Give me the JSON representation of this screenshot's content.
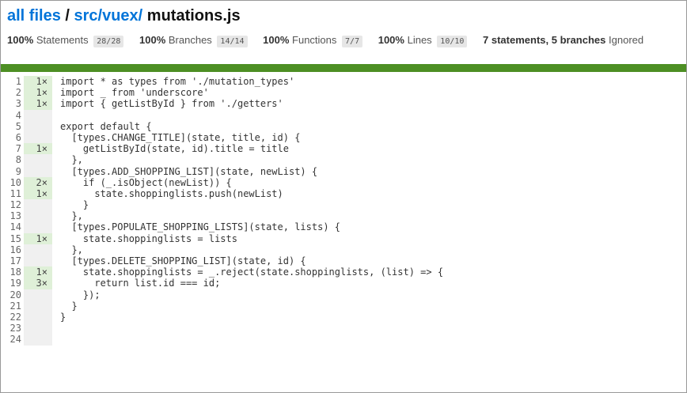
{
  "header": {
    "prefix": "all files",
    "sep1": " / ",
    "dir": "src/vuex/",
    "file": "mutations.js"
  },
  "summary": [
    {
      "pct": "100%",
      "label": "Statements",
      "frac": "28/28"
    },
    {
      "pct": "100%",
      "label": "Branches",
      "frac": "14/14"
    },
    {
      "pct": "100%",
      "label": "Functions",
      "frac": "7/7"
    },
    {
      "pct": "100%",
      "label": "Lines",
      "frac": "10/10"
    }
  ],
  "ignored": {
    "bold": "7 statements, 5 branches",
    "text": "Ignored"
  },
  "coverage_bar_color": "#4d8f24",
  "lines": [
    {
      "n": "1",
      "hits": "1×",
      "code": "import * as types from './mutation_types'"
    },
    {
      "n": "2",
      "hits": "1×",
      "code": "import _ from 'underscore'"
    },
    {
      "n": "3",
      "hits": "1×",
      "code": "import { getListById } from './getters'"
    },
    {
      "n": "4",
      "hits": "",
      "code": ""
    },
    {
      "n": "5",
      "hits": "",
      "code": "export default {"
    },
    {
      "n": "6",
      "hits": "",
      "code": "  [types.CHANGE_TITLE](state, title, id) {"
    },
    {
      "n": "7",
      "hits": "1×",
      "code": "    getListById(state, id).title = title"
    },
    {
      "n": "8",
      "hits": "",
      "code": "  },"
    },
    {
      "n": "9",
      "hits": "",
      "code": "  [types.ADD_SHOPPING_LIST](state, newList) {"
    },
    {
      "n": "10",
      "hits": "2×",
      "code": "    if (_.isObject(newList)) {"
    },
    {
      "n": "11",
      "hits": "1×",
      "code": "      state.shoppinglists.push(newList)"
    },
    {
      "n": "12",
      "hits": "",
      "code": "    }"
    },
    {
      "n": "13",
      "hits": "",
      "code": "  },"
    },
    {
      "n": "14",
      "hits": "",
      "code": "  [types.POPULATE_SHOPPING_LISTS](state, lists) {"
    },
    {
      "n": "15",
      "hits": "1×",
      "code": "    state.shoppinglists = lists"
    },
    {
      "n": "16",
      "hits": "",
      "code": "  },"
    },
    {
      "n": "17",
      "hits": "",
      "code": "  [types.DELETE_SHOPPING_LIST](state, id) {"
    },
    {
      "n": "18",
      "hits": "1×",
      "code": "    state.shoppinglists = _.reject(state.shoppinglists, (list) => {"
    },
    {
      "n": "19",
      "hits": "3×",
      "code": "      return list.id === id;"
    },
    {
      "n": "20",
      "hits": "",
      "code": "    });"
    },
    {
      "n": "21",
      "hits": "",
      "code": "  }"
    },
    {
      "n": "22",
      "hits": "",
      "code": "}"
    },
    {
      "n": "23",
      "hits": "",
      "code": ""
    },
    {
      "n": "24",
      "hits": "",
      "code": ""
    }
  ]
}
